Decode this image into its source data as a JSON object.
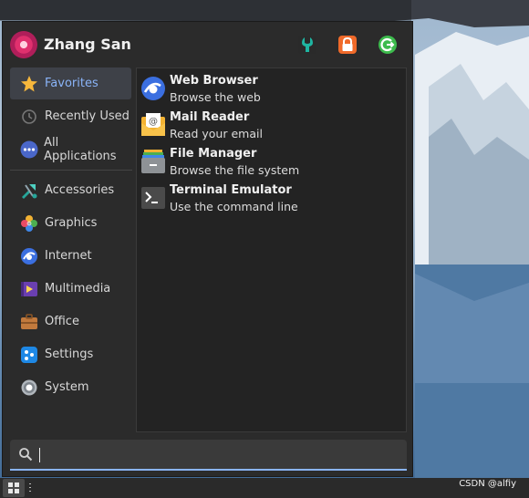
{
  "user": {
    "name": "Zhang San"
  },
  "header": {
    "buttons": [
      {
        "icon": "settings-manager-icon",
        "color": "#1fb5a2"
      },
      {
        "icon": "lock-screen-icon",
        "color": "#f06a2a"
      },
      {
        "icon": "log-out-icon",
        "color": "#3dbb4d"
      }
    ]
  },
  "sidebar": {
    "items": [
      {
        "label": "Favorites",
        "icon": "star-icon",
        "active": true
      },
      {
        "label": "Recently Used",
        "icon": "clock-icon"
      },
      {
        "label": "All Applications",
        "icon": "dots-icon"
      },
      {
        "label": "Accessories",
        "icon": "accessories-icon"
      },
      {
        "label": "Graphics",
        "icon": "graphics-icon"
      },
      {
        "label": "Internet",
        "icon": "internet-icon"
      },
      {
        "label": "Multimedia",
        "icon": "multimedia-icon"
      },
      {
        "label": "Office",
        "icon": "briefcase-icon"
      },
      {
        "label": "Settings",
        "icon": "settings-icon"
      },
      {
        "label": "System",
        "icon": "system-gear-icon"
      }
    ]
  },
  "apps": [
    {
      "name": "Web Browser",
      "description": "Browse the web",
      "icon": "web-browser-icon"
    },
    {
      "name": "Mail Reader",
      "description": "Read your email",
      "icon": "mail-icon"
    },
    {
      "name": "File Manager",
      "description": "Browse the file system",
      "icon": "file-manager-icon"
    },
    {
      "name": "Terminal Emulator",
      "description": "Use the command line",
      "icon": "terminal-icon"
    }
  ],
  "search": {
    "value": "",
    "placeholder": ""
  },
  "watermark": "CSDN @alfiy",
  "colors": {
    "accent": "#8ab4f8",
    "panel": "#2b2b2b",
    "active_item": "#3e4148"
  }
}
